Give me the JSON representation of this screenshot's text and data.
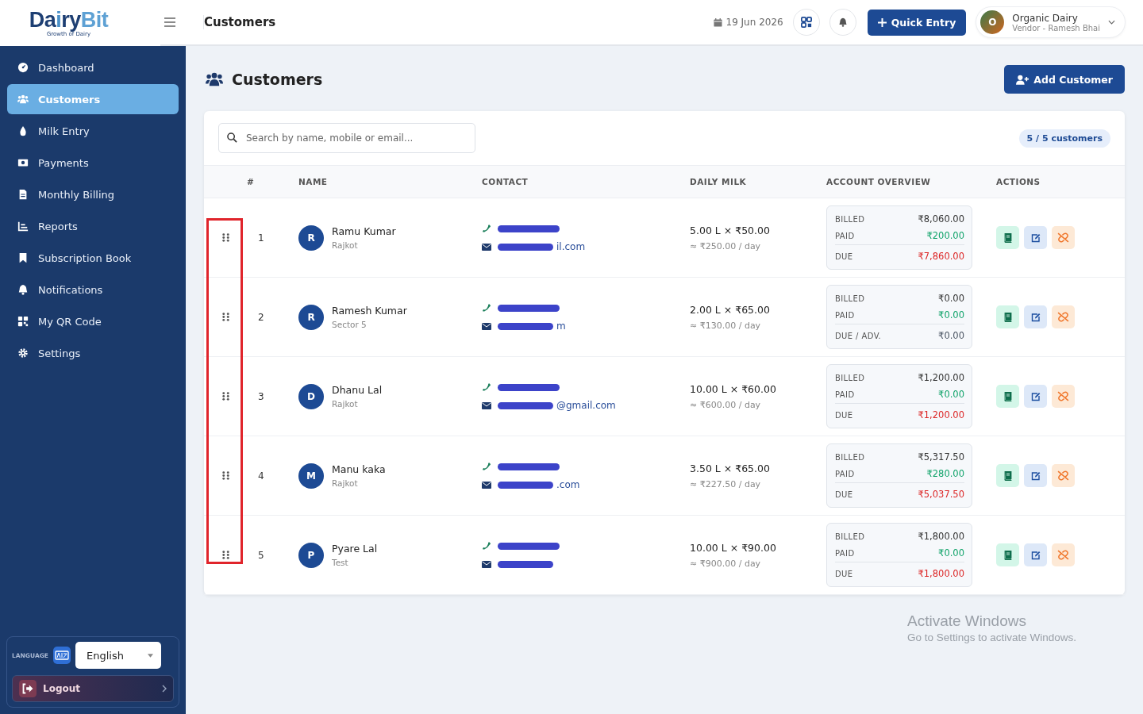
{
  "brand": {
    "name_dark": "Da",
    "name_mid": "i",
    "name_dark2": "ry",
    "name_light": "Bit",
    "tagline": "Growth of Dairy"
  },
  "topbar": {
    "title": "Customers",
    "date": "19 Jun 2026",
    "quick_entry": "Quick Entry",
    "account": {
      "initial": "O",
      "name": "Organic Dairy",
      "role": "Vendor - Ramesh Bhai"
    }
  },
  "sidebar": {
    "items": [
      {
        "label": "Dashboard",
        "selected": false
      },
      {
        "label": "Customers",
        "selected": true
      },
      {
        "label": "Milk Entry",
        "selected": false
      },
      {
        "label": "Payments",
        "selected": false
      },
      {
        "label": "Monthly Billing",
        "selected": false
      },
      {
        "label": "Reports",
        "selected": false
      },
      {
        "label": "Subscription Book",
        "selected": false
      },
      {
        "label": "Notifications",
        "selected": false
      },
      {
        "label": "My QR Code",
        "selected": false
      },
      {
        "label": "Settings",
        "selected": false
      }
    ],
    "language_label": "LANGUAGE",
    "language": "English",
    "logout": "Logout"
  },
  "page": {
    "title": "Customers",
    "add_button": "Add Customer",
    "search_placeholder": "Search by name, mobile or email...",
    "count": "5 / 5 customers",
    "highlight_drag_handles": true,
    "columns": [
      "#",
      "NAME",
      "CONTACT",
      "DAILY MILK",
      "ACCOUNT OVERVIEW",
      "ACTIONS"
    ],
    "rows": [
      {
        "index": "1",
        "initial": "R",
        "name": "Ramu Kumar",
        "area": "Rajkot",
        "email_visible": "il.com",
        "qty": "5.00 L × ₹50.00",
        "per_day": "≈ ₹250.00 / day",
        "billed_label": "BILLED",
        "billed": "₹8,060.00",
        "paid_label": "PAID",
        "paid": "₹200.00",
        "due_label": "DUE",
        "due": "₹7,860.00",
        "kind": "due"
      },
      {
        "index": "2",
        "initial": "R",
        "name": "Ramesh Kumar",
        "area": "Sector 5",
        "email_visible": "m",
        "qty": "2.00 L × ₹65.00",
        "per_day": "≈ ₹130.00 / day",
        "billed_label": "BILLED",
        "billed": "₹0.00",
        "paid_label": "PAID",
        "paid": "₹0.00",
        "due_label": "DUE / ADV.",
        "due": "₹0.00",
        "kind": "clear"
      },
      {
        "index": "3",
        "initial": "D",
        "name": "Dhanu Lal",
        "area": "Rajkot",
        "email_visible": "@gmail.com",
        "qty": "10.00 L × ₹60.00",
        "per_day": "≈ ₹600.00 / day",
        "billed_label": "BILLED",
        "billed": "₹1,200.00",
        "paid_label": "PAID",
        "paid": "₹0.00",
        "due_label": "DUE",
        "due": "₹1,200.00",
        "kind": "due"
      },
      {
        "index": "4",
        "initial": "M",
        "name": "Manu kaka",
        "area": "Rajkot",
        "email_visible": ".com",
        "qty": "3.50 L × ₹65.00",
        "per_day": "≈ ₹227.50 / day",
        "billed_label": "BILLED",
        "billed": "₹5,317.50",
        "paid_label": "PAID",
        "paid": "₹280.00",
        "due_label": "DUE",
        "due": "₹5,037.50",
        "kind": "due"
      },
      {
        "index": "5",
        "initial": "P",
        "name": "Pyare Lal",
        "area": "Test",
        "qty": "10.00 L × ₹90.00",
        "per_day": "≈ ₹900.00 / day",
        "billed_label": "BILLED",
        "billed": "₹1,800.00",
        "paid_label": "PAID",
        "paid": "₹0.00",
        "due_label": "DUE",
        "due": "₹1,800.00",
        "kind": "due"
      }
    ]
  },
  "os_notice": {
    "title": "Activate Windows",
    "text": "Go to Settings to activate Windows."
  }
}
